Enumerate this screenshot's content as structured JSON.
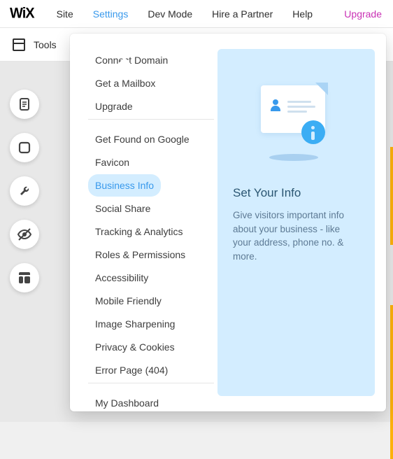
{
  "logo": "WiX",
  "topnav": {
    "items": [
      {
        "label": "Site"
      },
      {
        "label": "Settings",
        "active": true
      },
      {
        "label": "Dev Mode"
      },
      {
        "label": "Hire a Partner"
      },
      {
        "label": "Help"
      }
    ],
    "upgrade": "Upgrade"
  },
  "tools_label": "Tools",
  "settings_menu": {
    "group1": [
      "Connect Domain",
      "Get a Mailbox",
      "Upgrade"
    ],
    "group2": [
      "Get Found on Google",
      "Favicon",
      "Business Info",
      "Social Share",
      "Tracking & Analytics",
      "Roles & Permissions",
      "Accessibility",
      "Mobile Friendly",
      "Image Sharpening",
      "Privacy & Cookies",
      "Error Page (404)"
    ],
    "group3": [
      "My Dashboard"
    ],
    "hovered": "Business Info"
  },
  "preview": {
    "title": "Set Your Info",
    "description": "Give visitors important info about your business - like your address, phone no. & more."
  }
}
